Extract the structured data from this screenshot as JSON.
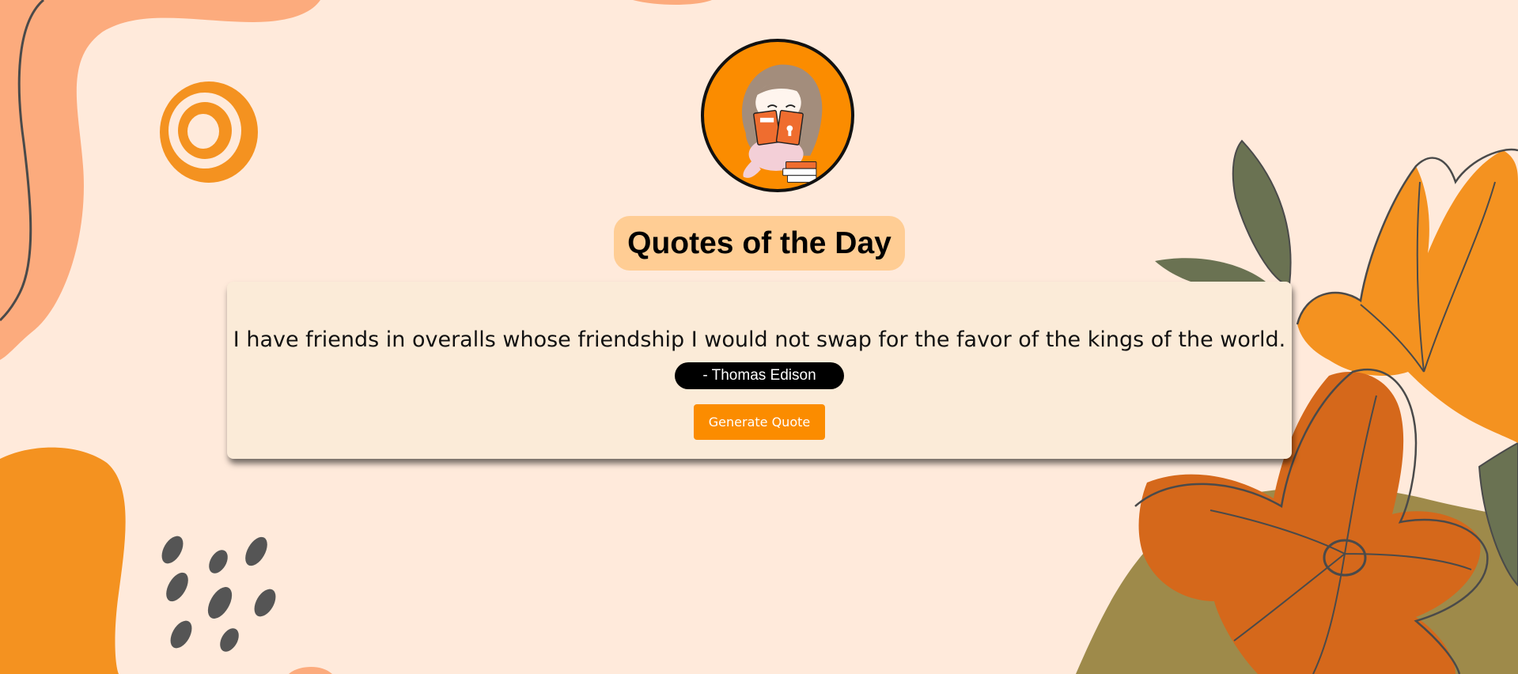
{
  "header": {
    "avatar_alt": "girl reading book illustration",
    "title": "Quotes of the Day"
  },
  "quote": {
    "text": "I have friends in overalls whose friendship I would not swap for the favor of the kings of the world.",
    "author": "- Thomas Edison"
  },
  "actions": {
    "generate_label": "Generate Quote"
  },
  "colors": {
    "background": "#ffeadb",
    "accent": "#fb8c00",
    "title_pill": "#ffcd94",
    "card": "#fbebd8",
    "author_pill": "#000000"
  }
}
